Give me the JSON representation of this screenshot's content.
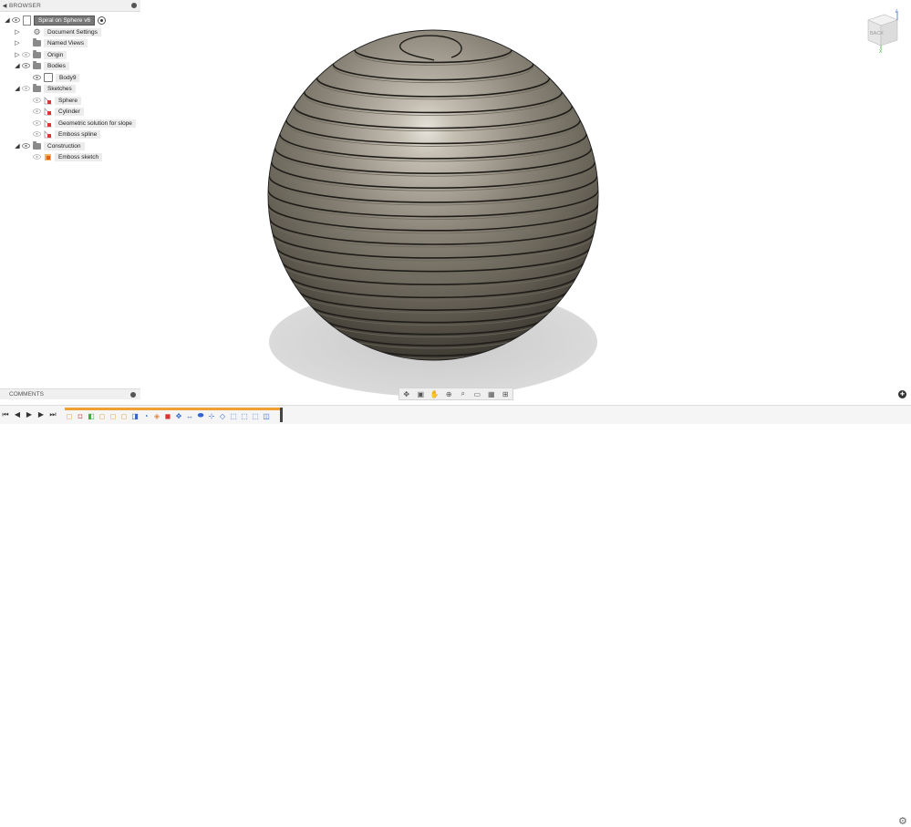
{
  "browser": {
    "title": "BROWSER",
    "root_label": "Spiral on Sphere v6",
    "items": [
      {
        "label": "Document Settings"
      },
      {
        "label": "Named Views"
      },
      {
        "label": "Origin"
      },
      {
        "label": "Bodies"
      },
      {
        "label": "Body9"
      },
      {
        "label": "Sketches"
      },
      {
        "label": "Sphere"
      },
      {
        "label": "Cylinder"
      },
      {
        "label": "Geometric solution for slope"
      },
      {
        "label": "Emboss spline"
      },
      {
        "label": "Construction"
      },
      {
        "label": "Emboss sketch"
      }
    ]
  },
  "comments": {
    "title": "COMMENTS"
  },
  "viewcube": {
    "face_label": "BACK",
    "axis_x": "X",
    "axis_z": "Z"
  },
  "nav_toolbar": {
    "icons": [
      "orbit-icon",
      "look-at-icon",
      "pan-icon",
      "zoom-icon",
      "zoom-window-icon",
      "display-settings-icon",
      "grid-icon",
      "viewports-icon"
    ]
  },
  "timeline": {
    "controls": [
      "go-to-start-icon",
      "step-back-icon",
      "play-icon",
      "step-forward-icon",
      "go-to-end-icon"
    ],
    "feature_count": 19
  },
  "colors": {
    "accent": "#f0a030",
    "sphere": "#7d7768",
    "shadow": "#cfcfcf"
  }
}
